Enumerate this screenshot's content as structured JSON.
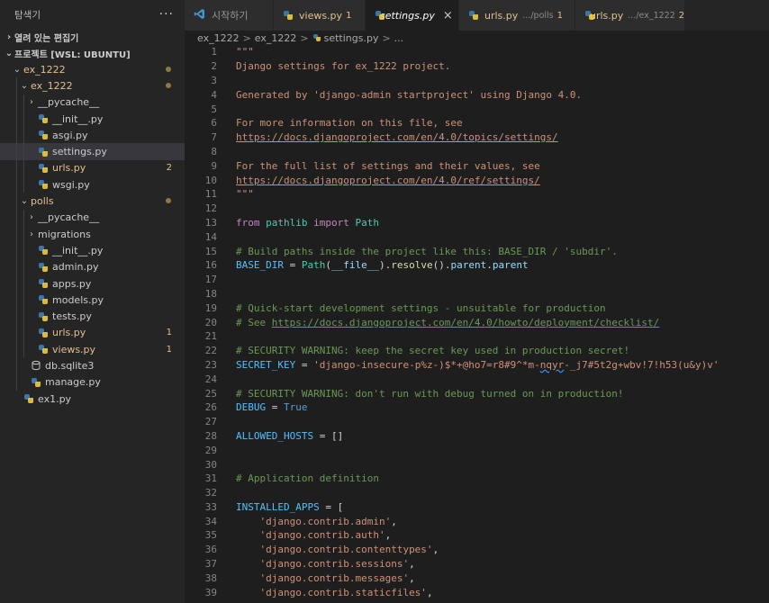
{
  "explorer": {
    "title": "탐색기",
    "open_editors_label": "열려 있는 편집기",
    "project_label": "프로젝트 [WSL: UBUNTU]",
    "tree": [
      {
        "label": "ex_1222",
        "depth": 1,
        "type": "folder",
        "expanded": true,
        "modified": true,
        "dot": true
      },
      {
        "label": "ex_1222",
        "depth": 2,
        "type": "folder",
        "expanded": true,
        "modified": true,
        "dot": true
      },
      {
        "label": "__pycache__",
        "depth": 3,
        "type": "folder",
        "expanded": false
      },
      {
        "label": "__init__.py",
        "depth": 3,
        "type": "py"
      },
      {
        "label": "asgi.py",
        "depth": 3,
        "type": "py"
      },
      {
        "label": "settings.py",
        "depth": 3,
        "type": "py",
        "selected": true
      },
      {
        "label": "urls.py",
        "depth": 3,
        "type": "py",
        "modified": true,
        "badge": "2"
      },
      {
        "label": "wsgi.py",
        "depth": 3,
        "type": "py"
      },
      {
        "label": "polls",
        "depth": 2,
        "type": "folder",
        "expanded": true,
        "modified": true,
        "dot": true
      },
      {
        "label": "__pycache__",
        "depth": 3,
        "type": "folder",
        "expanded": false
      },
      {
        "label": "migrations",
        "depth": 3,
        "type": "folder",
        "expanded": false
      },
      {
        "label": "__init__.py",
        "depth": 3,
        "type": "py"
      },
      {
        "label": "admin.py",
        "depth": 3,
        "type": "py"
      },
      {
        "label": "apps.py",
        "depth": 3,
        "type": "py"
      },
      {
        "label": "models.py",
        "depth": 3,
        "type": "py"
      },
      {
        "label": "tests.py",
        "depth": 3,
        "type": "py"
      },
      {
        "label": "urls.py",
        "depth": 3,
        "type": "py",
        "modified": true,
        "badge": "1"
      },
      {
        "label": "views.py",
        "depth": 3,
        "type": "py",
        "modified": true,
        "badge": "1"
      },
      {
        "label": "db.sqlite3",
        "depth": 2,
        "type": "db"
      },
      {
        "label": "manage.py",
        "depth": 2,
        "type": "py"
      },
      {
        "label": "ex1.py",
        "depth": 1,
        "type": "py"
      }
    ]
  },
  "tabs": [
    {
      "icon": "vscode-icon",
      "label": "시작하기",
      "active": false
    },
    {
      "icon": "python-icon",
      "label": "views.py",
      "count": "1",
      "modified": true
    },
    {
      "icon": "python-icon",
      "label": "settings.py",
      "active": true,
      "close": "×"
    },
    {
      "icon": "python-icon",
      "label": "urls.py",
      "desc": ".../polls",
      "count": "1",
      "modified": true
    },
    {
      "icon": "python-icon",
      "label": "urls.py",
      "desc": ".../ex_1222",
      "count": "2",
      "modified": true
    }
  ],
  "breadcrumb": {
    "items": [
      "ex_1222",
      "ex_1222",
      "settings.py",
      "..."
    ],
    "separator": ">"
  },
  "colors": {
    "background": "#1e1e1e",
    "sidebar": "#252526",
    "modified": "#e2c08d",
    "string": "#ce9178",
    "comment": "#6a9955",
    "keyword": "#c586c0"
  },
  "code_lines": [
    [
      {
        "t": "\"\"\"",
        "c": "str"
      }
    ],
    [
      {
        "t": "Django settings for ex_1222 project.",
        "c": "str"
      }
    ],
    [],
    [
      {
        "t": "Generated by 'django-admin startproject' using Django 4.0.",
        "c": "str"
      }
    ],
    [],
    [
      {
        "t": "For more information on this file, see",
        "c": "str"
      }
    ],
    [
      {
        "t": "https://docs.djangoproject.com/en/4.0/topics/settings/",
        "c": "url"
      }
    ],
    [],
    [
      {
        "t": "For the full list of settings and their values, see",
        "c": "str"
      }
    ],
    [
      {
        "t": "https://docs.djangoproject.com/en/4.0/ref/settings/",
        "c": "url"
      }
    ],
    [
      {
        "t": "\"\"\"",
        "c": "str"
      }
    ],
    [],
    [
      {
        "t": "from",
        "c": "kw"
      },
      {
        "t": " pathlib ",
        "c": "cls"
      },
      {
        "t": "import",
        "c": "kw"
      },
      {
        "t": " Path",
        "c": "cls"
      }
    ],
    [],
    [
      {
        "t": "# Build paths inside the project like this: BASE_DIR / 'subdir'.",
        "c": "cmt"
      }
    ],
    [
      {
        "t": "BASE_DIR",
        "c": "var"
      },
      {
        "t": " = ",
        "c": "op"
      },
      {
        "t": "Path",
        "c": "cls"
      },
      {
        "t": "(",
        "c": "op"
      },
      {
        "t": "__file__",
        "c": "dunder"
      },
      {
        "t": ").",
        "c": "op"
      },
      {
        "t": "resolve",
        "c": "fn"
      },
      {
        "t": "().",
        "c": "op"
      },
      {
        "t": "parent",
        "c": "prop"
      },
      {
        "t": ".",
        "c": "op"
      },
      {
        "t": "parent",
        "c": "prop"
      }
    ],
    [],
    [],
    [
      {
        "t": "# Quick-start development settings - unsuitable for production",
        "c": "cmt"
      }
    ],
    [
      {
        "t": "# See ",
        "c": "cmt"
      },
      {
        "t": "https://docs.djangoproject.com/en/4.0/howto/deployment/checklist/",
        "c": "cmturl"
      }
    ],
    [],
    [
      {
        "t": "# SECURITY WARNING: keep the secret key used in production secret!",
        "c": "cmt"
      }
    ],
    [
      {
        "t": "SECRET_KEY",
        "c": "var"
      },
      {
        "t": " = ",
        "c": "op"
      },
      {
        "t": "'django-insecure-p%z-)$*+@ho7=r8#9^*m-",
        "c": "str"
      },
      {
        "t": "nqyr",
        "c": "strsq"
      },
      {
        "t": "-_j7#5t2g+wbv!7!h53(u&y)v'",
        "c": "str"
      }
    ],
    [],
    [
      {
        "t": "# SECURITY WARNING: don't run with debug turned on in production!",
        "c": "cmt"
      }
    ],
    [
      {
        "t": "DEBUG",
        "c": "var"
      },
      {
        "t": " = ",
        "c": "op"
      },
      {
        "t": "True",
        "c": "const"
      }
    ],
    [],
    [
      {
        "t": "ALLOWED_HOSTS",
        "c": "var"
      },
      {
        "t": " = []",
        "c": "op"
      }
    ],
    [],
    [],
    [
      {
        "t": "# Application definition",
        "c": "cmt"
      }
    ],
    [],
    [
      {
        "t": "INSTALLED_APPS",
        "c": "var"
      },
      {
        "t": " = [",
        "c": "op"
      }
    ],
    [
      {
        "t": "    ",
        "c": "op"
      },
      {
        "t": "'django.contrib.admin'",
        "c": "str"
      },
      {
        "t": ",",
        "c": "op"
      }
    ],
    [
      {
        "t": "    ",
        "c": "op"
      },
      {
        "t": "'django.contrib.auth'",
        "c": "str"
      },
      {
        "t": ",",
        "c": "op"
      }
    ],
    [
      {
        "t": "    ",
        "c": "op"
      },
      {
        "t": "'django.contrib.contenttypes'",
        "c": "str"
      },
      {
        "t": ",",
        "c": "op"
      }
    ],
    [
      {
        "t": "    ",
        "c": "op"
      },
      {
        "t": "'django.contrib.sessions'",
        "c": "str"
      },
      {
        "t": ",",
        "c": "op"
      }
    ],
    [
      {
        "t": "    ",
        "c": "op"
      },
      {
        "t": "'django.contrib.messages'",
        "c": "str"
      },
      {
        "t": ",",
        "c": "op"
      }
    ],
    [
      {
        "t": "    ",
        "c": "op"
      },
      {
        "t": "'django.contrib.staticfiles'",
        "c": "str"
      },
      {
        "t": ",",
        "c": "op"
      }
    ]
  ]
}
